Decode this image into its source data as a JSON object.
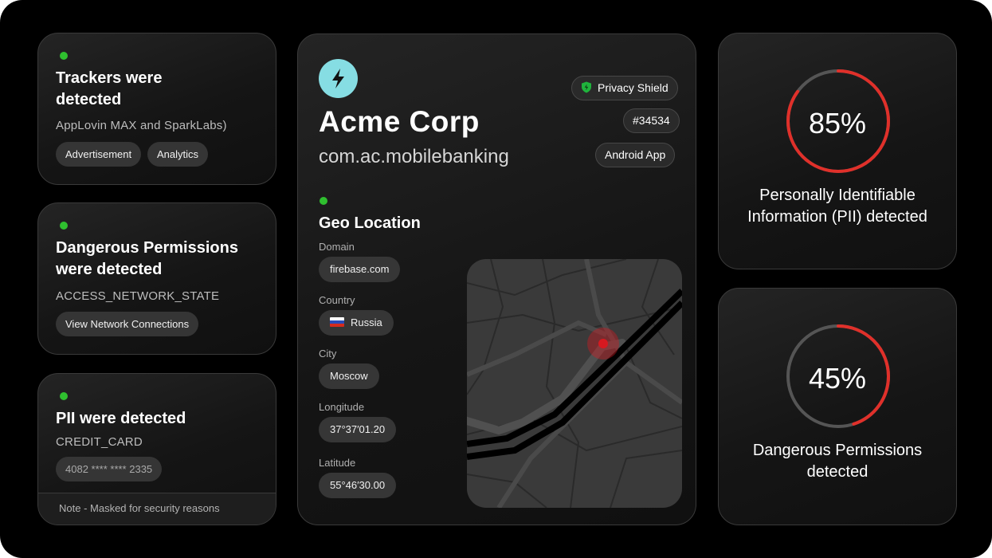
{
  "trackers": {
    "title_line1": "Trackers were",
    "title_line2": "detected",
    "subtitle": "AppLovin MAX and SparkLabs)",
    "tags": [
      "Advertisement",
      "Analytics"
    ]
  },
  "permissions": {
    "title_line1": "Dangerous Permissions",
    "title_line2": "were detected",
    "subtitle": "ACCESS_NETWORK_STATE",
    "tags": [
      "View Network Connections"
    ]
  },
  "pii": {
    "title": "PII were detected",
    "subtitle": "CREDIT_CARD",
    "masked_value": "4082 **** **** 2335",
    "note": "Note - Masked for security reasons"
  },
  "app": {
    "name": "Acme Corp",
    "package": "com.ac.mobilebanking",
    "logo_icon": "bolt-icon",
    "badges": {
      "shield": "Privacy Shield",
      "id": "#34534",
      "platform": "Android App"
    }
  },
  "geo": {
    "title": "Geo Location",
    "domain_label": "Domain",
    "domain": "firebase.com",
    "country_label": "Country",
    "country": "Russia",
    "city_label": "City",
    "city": "Moscow",
    "longitude_label": "Longitude",
    "longitude": "37°37′01.20",
    "latitude_label": "Latitude",
    "latitude": "55°46′30.00"
  },
  "gauges": {
    "pii_percent_label": "85%",
    "pii_fraction": 0.85,
    "pii_caption_line1": "Personally Identifiable",
    "pii_caption_line2": "Information (PII) detected",
    "perm_percent_label": "45%",
    "perm_fraction": 0.45,
    "perm_caption_line1": "Dangerous Permissions",
    "perm_caption_line2": "detected"
  },
  "colors": {
    "status_dot": "#2fbf2f",
    "gauge_red": "#e0302a",
    "logo_teal": "#86dde3",
    "shield_green": "#1fb33c",
    "map_pin": "#d71920"
  }
}
